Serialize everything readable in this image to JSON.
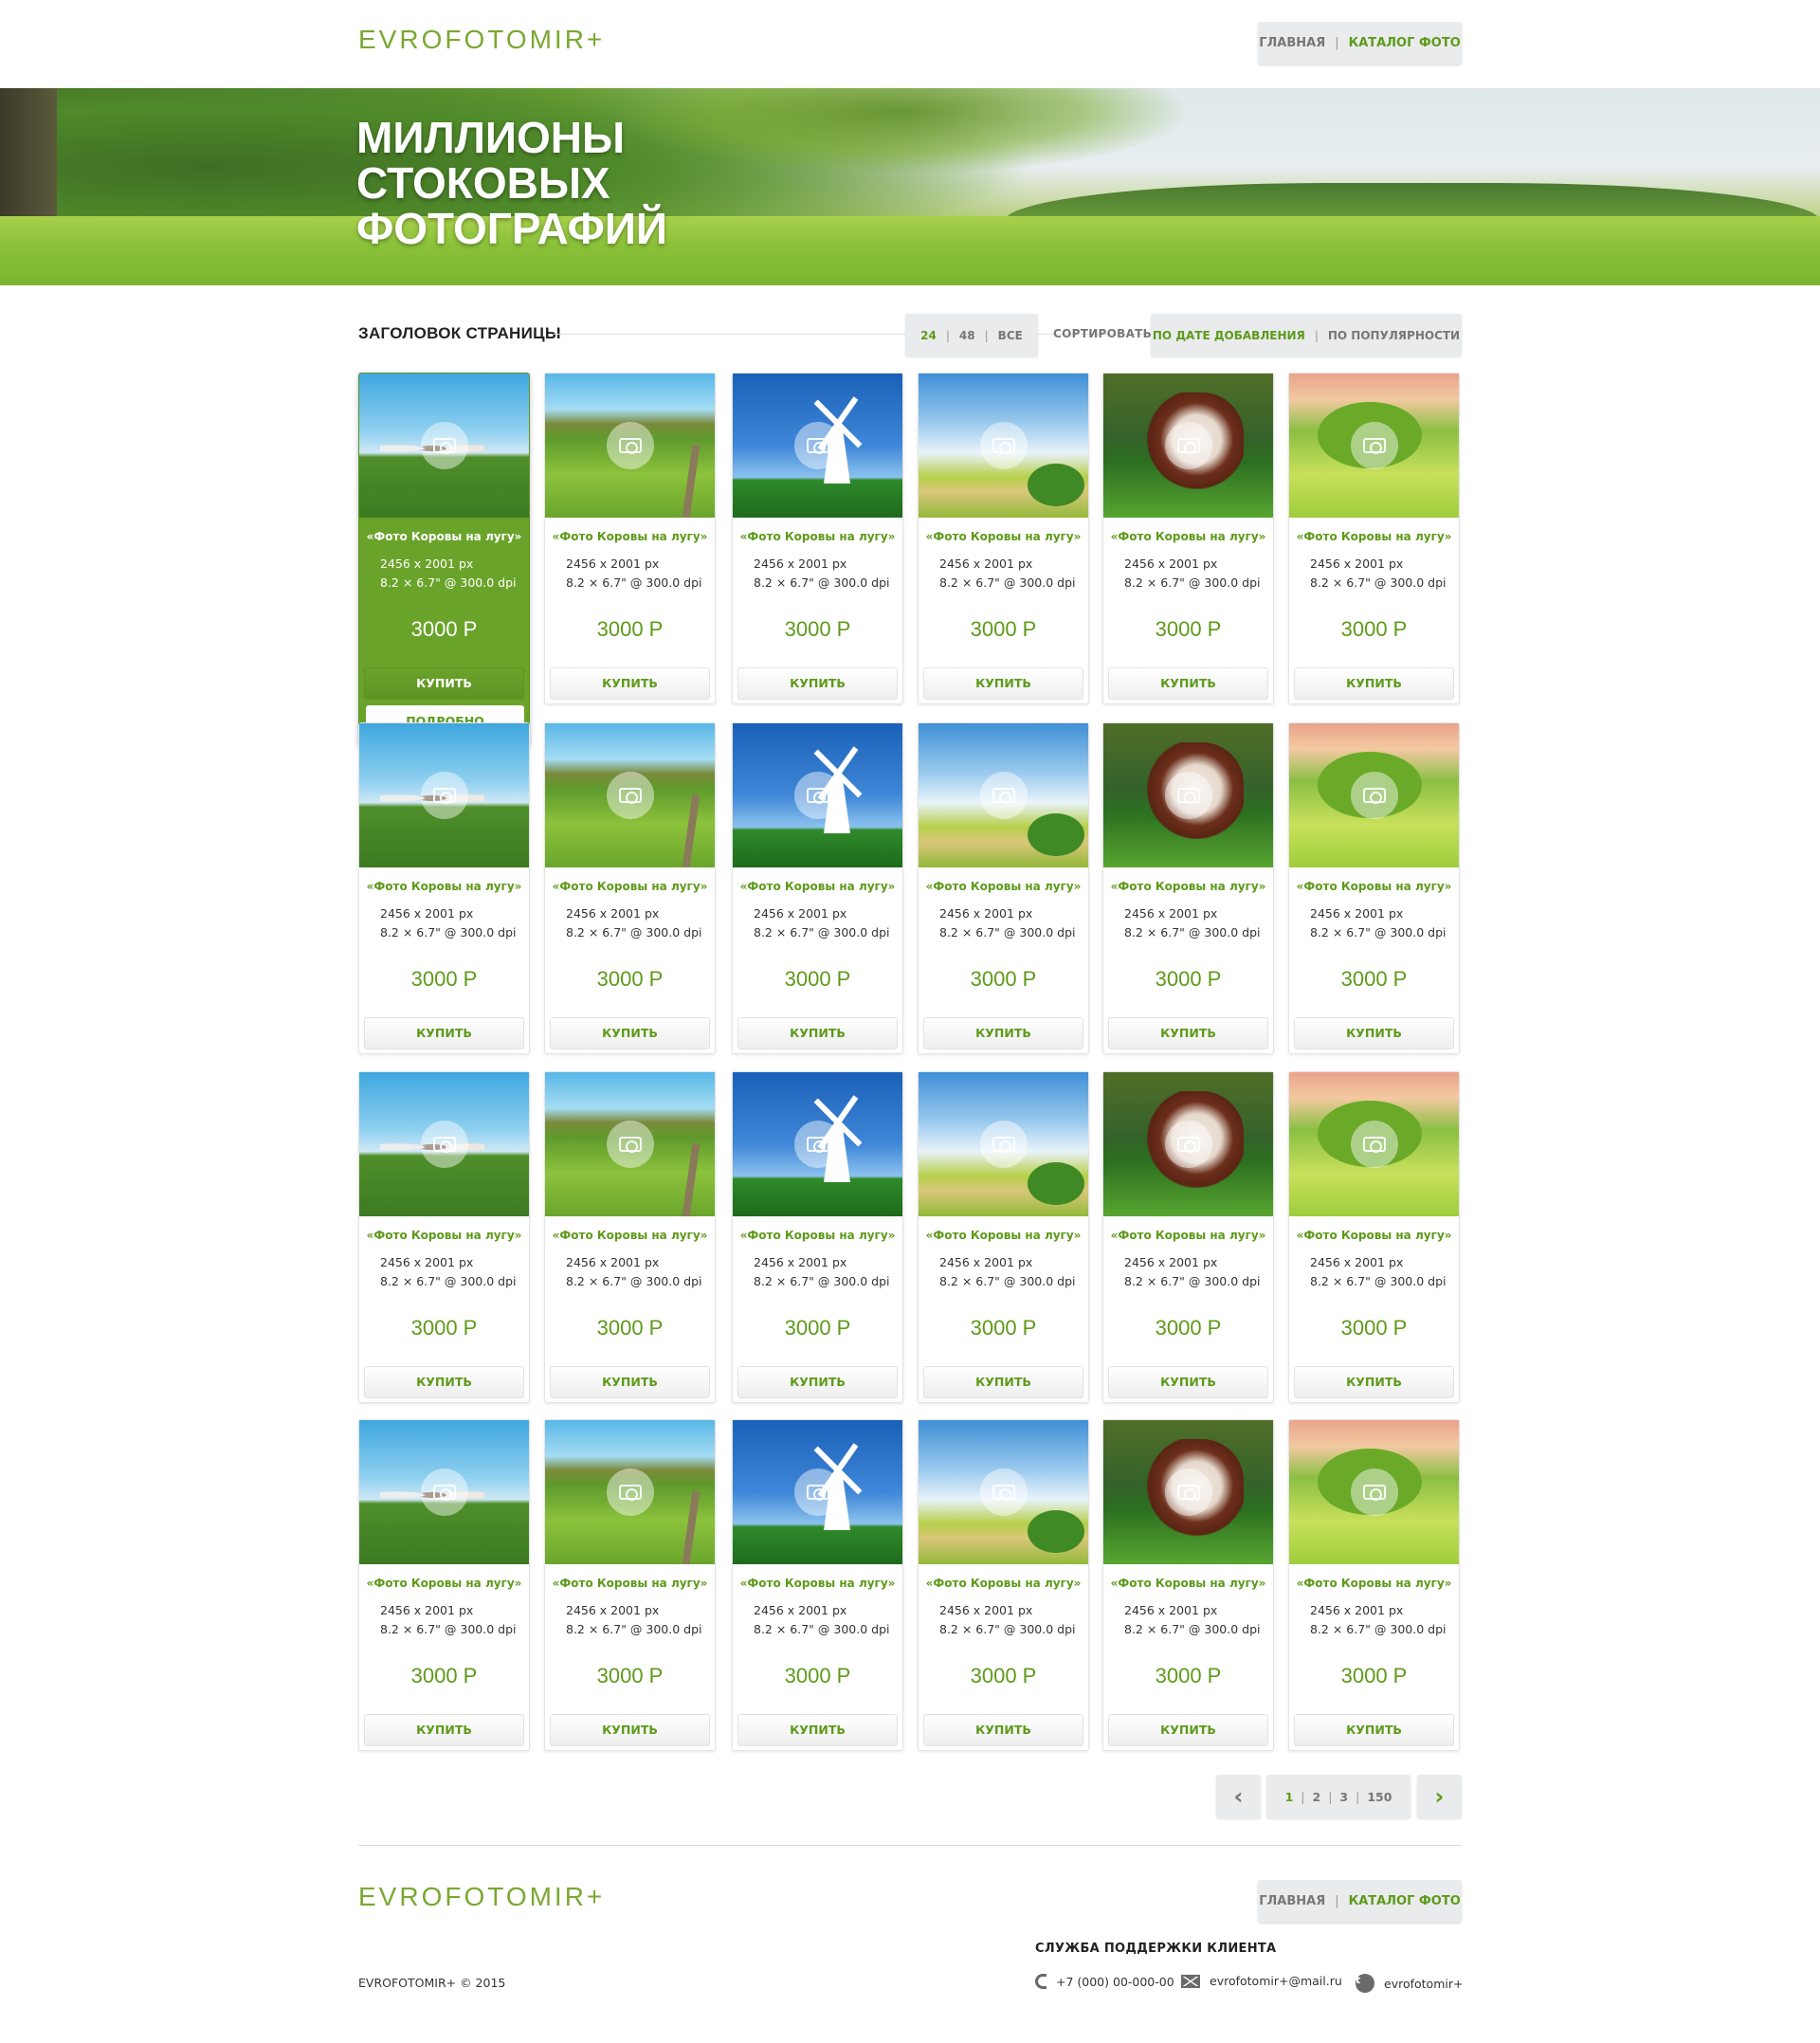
{
  "brand": {
    "logo": "EVROFOTOMIR+"
  },
  "nav": {
    "home": "ГЛАВНАЯ",
    "catalog": "КАТАЛОГ ФОТО",
    "separator": "|"
  },
  "hero": {
    "line1": "МИЛЛИОНЫ",
    "line2": "СТОКОВЫХ",
    "line3": "ФОТОГРАФИЙ"
  },
  "toolbar": {
    "page_title": "ЗАГОЛОВОК СТРАНИЦЫ",
    "perpage": [
      "24",
      "48",
      "ВСЕ"
    ],
    "perpage_active": "24",
    "sort_label": "СОРТИРОВАТЬ",
    "sort_options": [
      "ПО ДАТЕ ДОБАВЛЕНИЯ",
      "ПО ПОПУЛЯРНОСТИ"
    ],
    "sort_active": "ПО ДАТЕ ДОБАВЛЕНИЯ"
  },
  "product_template": {
    "name": "«Фото Коровы на лугу»",
    "resolution": "2456 x 2001 px",
    "print_size": "8.2 × 6.7\" @ 300.0 dpi",
    "price": "3000 Р",
    "buy_label": "КУПИТЬ",
    "details_label": "ПОДРОБНО"
  },
  "photo_themes": [
    "cows",
    "hills",
    "mill",
    "path",
    "cow",
    "sunset"
  ],
  "grid": {
    "rows": 4,
    "featured_index": 0
  },
  "pagination": {
    "pages": [
      "1",
      "2",
      "3",
      "150"
    ],
    "active": "1",
    "prev_icon": "chevron-left-icon",
    "next_icon": "chevron-right-icon"
  },
  "footer": {
    "support_title": "СЛУЖБА ПОДДЕРЖКИ КЛИЕНТА",
    "copyright": "EVROFOTOMIR+ © 2015",
    "phone": "+7 (000) 00-000-00",
    "email": "evrofotomir+@mail.ru",
    "twitter": "evrofotomir+"
  },
  "colors": {
    "accent": "#5e9a1a",
    "featured_bg": "#6aa32a",
    "button_bg": "#e9ebec"
  }
}
